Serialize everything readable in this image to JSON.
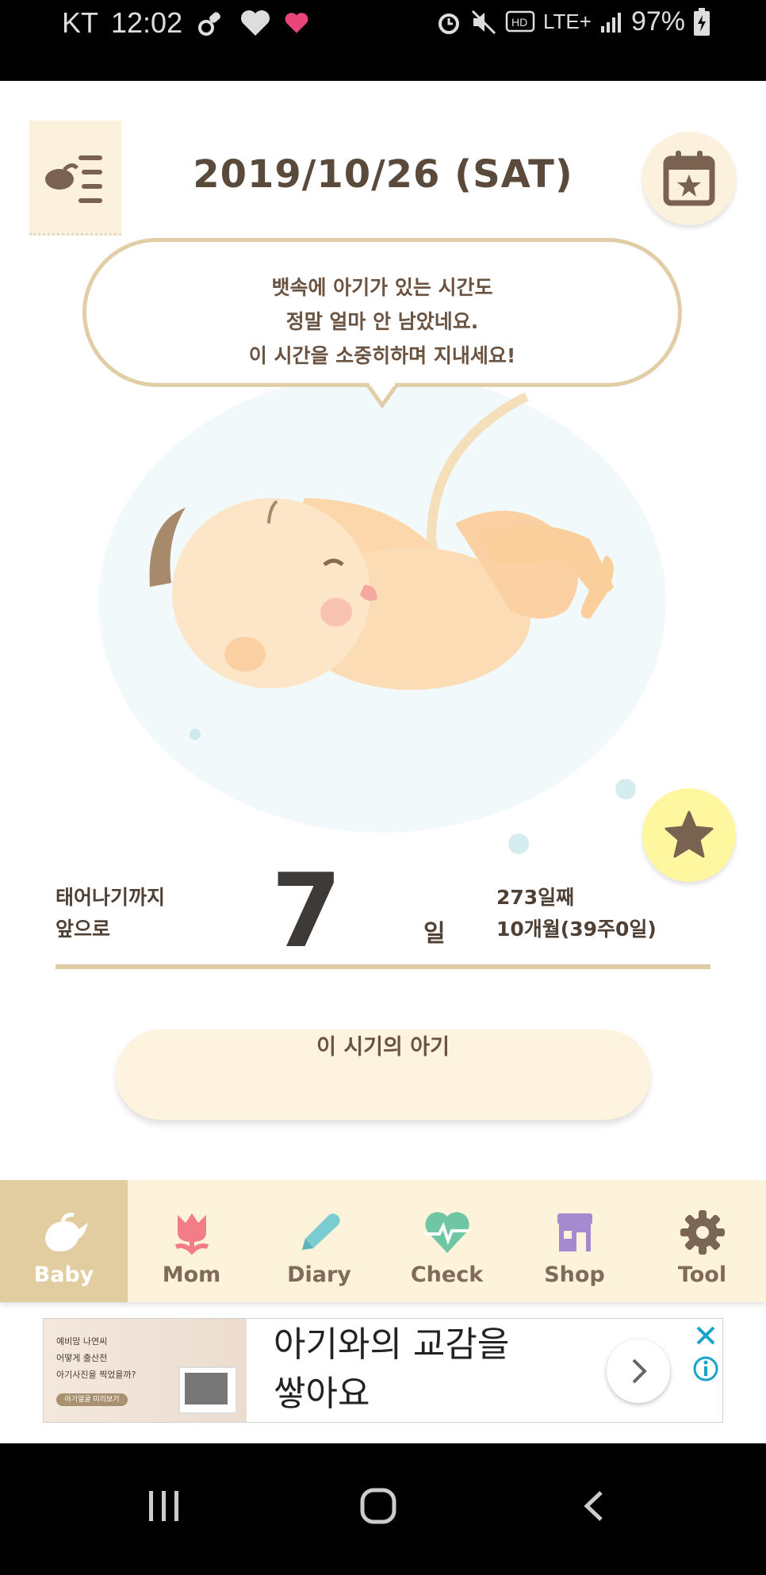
{
  "status_bar": {
    "carrier": "KT",
    "time": "12:02",
    "network": "LTE+",
    "battery": "97%"
  },
  "header": {
    "date": "2019/10/26 (SAT)"
  },
  "bubble": {
    "line1": "뱃속에 아기가 있는 시간도",
    "line2": "정말 얼마 안 남았네요.",
    "line3": "이 시간을 소중히하며 지내세요!"
  },
  "countdown": {
    "label_line1": "태어나기까지",
    "label_line2": "앞으로",
    "days": "7",
    "unit": "일",
    "day_count": "273일째",
    "week_info": "10개월(39주0일)"
  },
  "period_button": "이 시기의 아기",
  "tabs": [
    {
      "label": "Baby",
      "icon": "bird-icon",
      "color": "#ffffff",
      "active": true
    },
    {
      "label": "Mom",
      "icon": "tulip-icon",
      "color": "#f27d86",
      "active": false
    },
    {
      "label": "Diary",
      "icon": "pencil-icon",
      "color": "#79cccf",
      "active": false
    },
    {
      "label": "Check",
      "icon": "heart-pulse-icon",
      "color": "#6fc6a2",
      "active": false
    },
    {
      "label": "Shop",
      "icon": "shop-icon",
      "color": "#a58ad0",
      "active": false
    },
    {
      "label": "Tool",
      "icon": "gear-icon",
      "color": "#7b6656",
      "active": false
    }
  ],
  "ad": {
    "thumb_line1": "예비맘 나연씨",
    "thumb_line2": "어떻게 출산전",
    "thumb_line3": "아기사진을 찍었을까?",
    "thumb_cta": "아기얼굴 미리보기",
    "headline_line1": "아기와의 교감을",
    "headline_line2": "쌓아요"
  },
  "colors": {
    "accent": "#e2cda1",
    "cream": "#fdf2da",
    "text_brown": "#6a5340"
  }
}
